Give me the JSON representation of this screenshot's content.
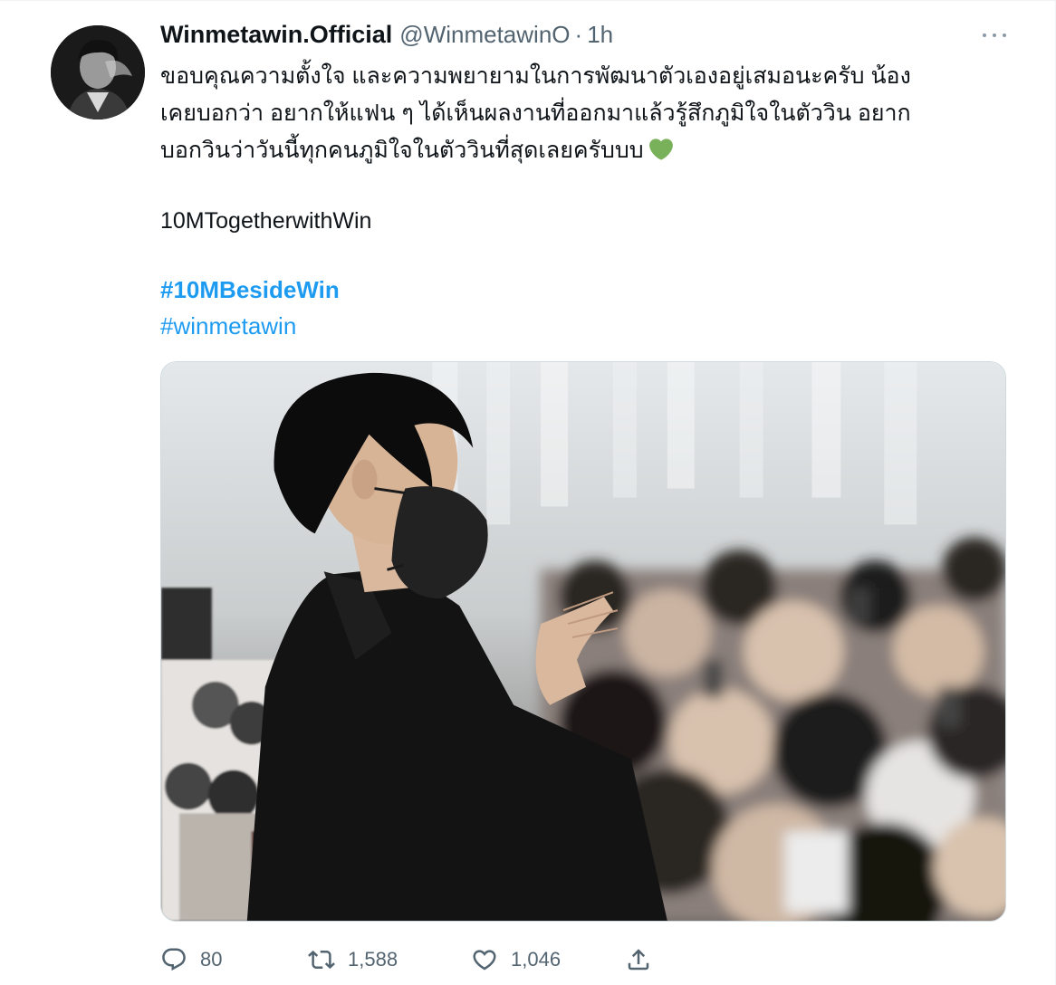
{
  "tweet": {
    "author": {
      "display_name": "Winmetawin.Official",
      "handle": "@WinmetawinO",
      "separator": "·",
      "time": "1h"
    },
    "text_lines": [
      "ขอบคุณความตั้งใจ และความพยายามในการพัฒนาตัวเองอยู่เสมอนะครับ น้อง",
      "เคยบอกว่า อยากให้แฟน ๆ ได้เห็นผลงานที่ออกมาแล้วรู้สึกภูมิใจในตัววิน อยาก",
      "บอกวินว่าวันนี้ทุกคนภูมิใจในตัววินที่สุดเลยครับบบ"
    ],
    "emoji": "green-heart",
    "tag_text": "10MTogetherwithWin",
    "hashtags": [
      "#10MBesideWin",
      "#winmetawin"
    ],
    "actions": {
      "replies": "80",
      "retweets": "1,588",
      "likes": "1,046"
    },
    "colors": {
      "link": "#1d9bf0",
      "muted": "#536471",
      "heart": "#78b159"
    }
  }
}
